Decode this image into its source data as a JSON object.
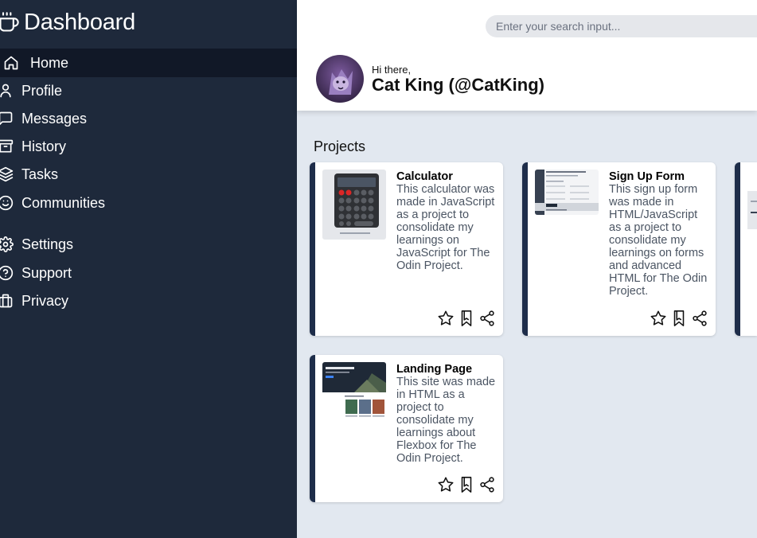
{
  "sidebar": {
    "brand": "Dashboard",
    "items": [
      {
        "label": "Home",
        "icon": "home-icon",
        "active": true
      },
      {
        "label": "Profile",
        "icon": "user-icon"
      },
      {
        "label": "Messages",
        "icon": "message-icon"
      },
      {
        "label": "History",
        "icon": "archive-icon"
      },
      {
        "label": "Tasks",
        "icon": "layers-icon"
      },
      {
        "label": "Communities",
        "icon": "smile-icon"
      },
      {
        "label": "Settings",
        "icon": "gear-icon"
      },
      {
        "label": "Support",
        "icon": "help-icon"
      },
      {
        "label": "Privacy",
        "icon": "briefcase-icon"
      }
    ]
  },
  "header": {
    "search_placeholder": "Enter your search input...",
    "greeting": "Hi there,",
    "user_name": "Cat King (@CatKing)"
  },
  "projects": {
    "title": "Projects",
    "cards": [
      {
        "title": "Calculator",
        "description": "This calculator was made in JavaScript as a project to consolidate my learnings on JavaScript for The Odin Project."
      },
      {
        "title": "Sign Up Form",
        "description": "This sign up form was made in HTML/JavaScript as a project to consolidate my learnings on forms and advanced HTML for The Odin Project."
      },
      {
        "title": "Landing Page",
        "description": "This site was made in HTML as a project to consolidate my learnings about Flexbox for The Odin Project."
      }
    ]
  },
  "colors": {
    "sidebar_bg": "#1e293b",
    "active_bg": "#111827",
    "card_accent": "#1e2d4a",
    "main_bg": "#e2e8f0"
  }
}
